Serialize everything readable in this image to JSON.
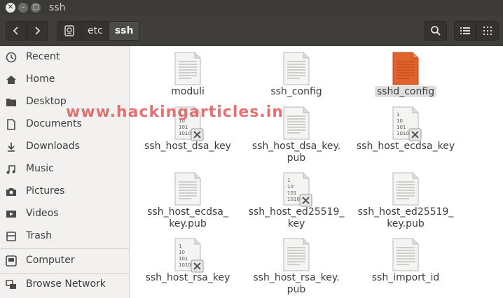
{
  "window": {
    "title": "ssh"
  },
  "toolbar": {
    "back_icon": "chevron-left-icon",
    "forward_icon": "chevron-right-icon",
    "breadcrumbs": [
      "etc",
      "ssh"
    ],
    "search_icon": "search-icon",
    "list_view_icon": "list-view-icon",
    "grid_view_icon": "grid-view-icon"
  },
  "sidebar": {
    "items": [
      {
        "label": "Recent",
        "icon": "clock-icon"
      },
      {
        "label": "Home",
        "icon": "home-icon"
      },
      {
        "label": "Desktop",
        "icon": "folder-icon"
      },
      {
        "label": "Documents",
        "icon": "document-icon"
      },
      {
        "label": "Downloads",
        "icon": "download-icon"
      },
      {
        "label": "Music",
        "icon": "music-icon"
      },
      {
        "label": "Pictures",
        "icon": "camera-icon"
      },
      {
        "label": "Videos",
        "icon": "video-icon"
      },
      {
        "label": "Trash",
        "icon": "trash-icon"
      },
      {
        "label": "Computer",
        "icon": "computer-icon"
      },
      {
        "label": "Browse Network",
        "icon": "network-icon"
      }
    ]
  },
  "files": [
    {
      "name": "moduli",
      "type": "text",
      "selected": false
    },
    {
      "name": "ssh_config",
      "type": "text",
      "selected": false
    },
    {
      "name": "sshd_config",
      "type": "text",
      "selected": true
    },
    {
      "name": "ssh_host_dsa_key",
      "type": "binary-locked",
      "selected": false
    },
    {
      "name": "ssh_host_dsa_key.\npub",
      "type": "text",
      "selected": false
    },
    {
      "name": "ssh_host_ecdsa_key",
      "type": "binary-locked",
      "selected": false
    },
    {
      "name": "ssh_host_ecdsa_\nkey.pub",
      "type": "text",
      "selected": false
    },
    {
      "name": "ssh_host_ed25519_\nkey",
      "type": "binary-locked",
      "selected": false
    },
    {
      "name": "ssh_host_ed25519_\nkey.pub",
      "type": "text",
      "selected": false
    },
    {
      "name": "ssh_host_rsa_key",
      "type": "binary-locked",
      "selected": false
    },
    {
      "name": "ssh_host_rsa_key.\npub",
      "type": "text",
      "selected": false
    },
    {
      "name": "ssh_import_id",
      "type": "text",
      "selected": false
    }
  ],
  "watermark": "www.hackingarticles.in",
  "colors": {
    "selected_file": "#e2622e",
    "titlebar": "#3b3a37",
    "toolbar": "#3f3e3b",
    "sidebar": "#f2f1f0"
  }
}
